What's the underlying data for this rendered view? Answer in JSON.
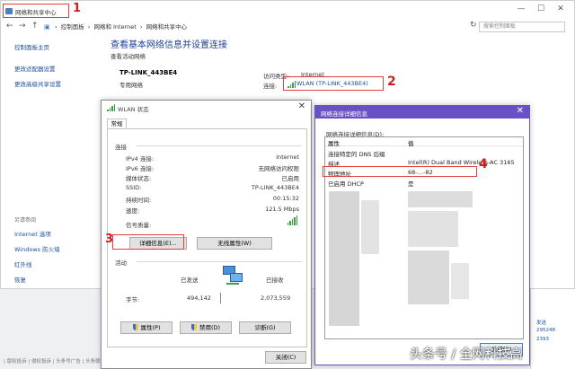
{
  "window": {
    "title": "网络和共享中心",
    "marker": "1",
    "controls": {
      "minimize": "—",
      "maximize": "☐",
      "close": "✕"
    }
  },
  "addressbar": {
    "back": "←",
    "forward": "→",
    "up": "↑",
    "crumbs": [
      "控制面板",
      "网络和 Internet",
      "网络和共享中心"
    ],
    "separator": "›",
    "search_placeholder": "搜索控制面板"
  },
  "sidebar": {
    "items": [
      "控制面板主页",
      "更改适配器设置",
      "更改高级共享设置"
    ],
    "see_also_title": "另请参阅",
    "see_also": [
      "Internet 选项",
      "Windows 防火墙",
      "红外线",
      "恢复"
    ]
  },
  "main": {
    "heading": "查看基本网络信息并设置连接",
    "active_networks_label": "查看活动网络",
    "network_name": "TP-LINK_443BE4",
    "network_type": "专用网络",
    "access_type_label": "访问类型:",
    "access_type_value": "Internet",
    "connections_label": "连接:",
    "connection_link": "WLAN (TP-LINK_443BE4)",
    "marker": "2"
  },
  "wlan_dialog": {
    "title": "WLAN 状态",
    "close": "✕",
    "tab": "常规",
    "connection_group": "连接",
    "rows": [
      {
        "label": "IPv4 连接:",
        "value": "Internet"
      },
      {
        "label": "IPv6 连接:",
        "value": "无网络访问权限"
      },
      {
        "label": "媒体状态:",
        "value": "已启用"
      },
      {
        "label": "SSID:",
        "value": "TP-LINK_443BE4"
      },
      {
        "label": "持续时间:",
        "value": "00:15:32"
      },
      {
        "label": "速度:",
        "value": "121.5 Mbps"
      }
    ],
    "signal_label": "信号质量:",
    "details_button": "详细信息(E)...",
    "wireless_props_button": "无线属性(W)",
    "marker": "3",
    "activity_group": "活动",
    "sent_label": "已发送",
    "received_label": "已接收",
    "bytes_label": "字节:",
    "bytes_sent": "494,142",
    "bytes_received": "2,073,559",
    "properties_button": "属性(P)",
    "disable_button": "禁用(D)",
    "diagnose_button": "诊断(G)",
    "close_button": "关闭(C)"
  },
  "details_dialog": {
    "title": "网络连接详细信息",
    "close": "✕",
    "subtitle": "网络连接详细信息(D):",
    "col_property": "属性",
    "col_value": "值",
    "rows": [
      {
        "property": "连接特定的 DNS 后缀",
        "value": ""
      },
      {
        "property": "描述",
        "value": "Intel(R) Dual Band Wireless-AC 3165"
      },
      {
        "property": "物理地址",
        "value": "68-…-82"
      },
      {
        "property": "已启用 DHCP",
        "value": "是"
      }
    ],
    "marker": "4",
    "close_button": "关闭(C)"
  },
  "peek": {
    "items": [
      "发送",
      "295248",
      "2393"
    ]
  },
  "statusbar": {
    "text": "| 版权投诉 | 侵权投诉 | 头条号广告 | 头条联系"
  },
  "watermark": "头条号 / 全网科技高"
}
